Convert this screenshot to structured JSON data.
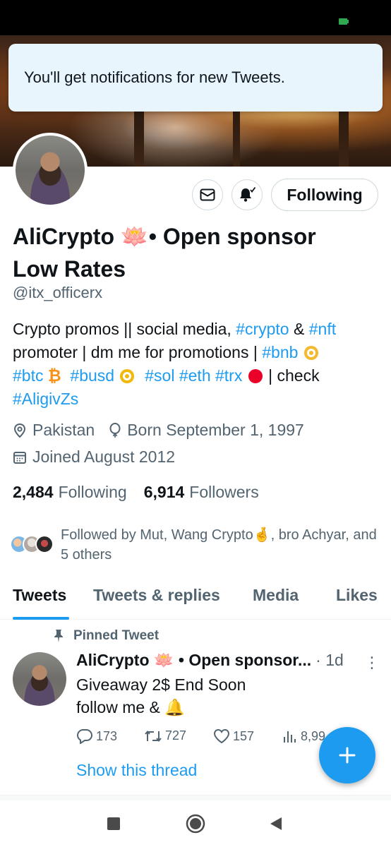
{
  "toast": {
    "message": "You'll get notifications for new Tweets."
  },
  "profile": {
    "display_name_part1": "AliCrypto ",
    "lotus_emoji": "🪷",
    "display_name_part2": "• Open sponsor",
    "display_name_line2": "Low Rates",
    "handle": "@itx_officerx",
    "follow_button": "Following",
    "bio": {
      "line1_text": "Crypto promos || social media, ",
      "tag_crypto": "#crypto",
      "amp": " & ",
      "tag_nft": "#nft",
      "line2_text": "promoter | dm me for promotions | ",
      "tag_bnb": "#bnb",
      "tag_btc": "#btc",
      "btc_symbol": "₿",
      "tag_busd": "#busd",
      "tag_sol": "#sol",
      "tag_eth": "#eth",
      "tag_trx": "#trx",
      "check_text": " | check",
      "tag_aligivzs": "#AligivZs"
    },
    "location": "Pakistan",
    "birthday": "Born September 1, 1997",
    "joined": "Joined August 2012",
    "following_count": "2,484",
    "following_label": "Following",
    "followers_count": "6,914",
    "followers_label": "Followers",
    "followed_by": "Followed by Mut, Wang Crypto🤞, bro Achyar, and 5 others"
  },
  "tabs": [
    {
      "label": "Tweets"
    },
    {
      "label": "Tweets & replies"
    },
    {
      "label": "Media"
    },
    {
      "label": "Likes"
    }
  ],
  "tweet": {
    "pinned_label": "Pinned Tweet",
    "name": "AliCrypto 🪷 • Open sponsor...",
    "time": "· 1d",
    "more": "⋮",
    "body_line1": "Giveaway 2$ End Soon",
    "body_line2": "follow me & 🔔",
    "replies": "173",
    "retweets": "727",
    "likes": "157",
    "views": "8,99",
    "show_thread": "Show this thread"
  },
  "colors": {
    "accent": "#1d9bf0",
    "text": "#0f1419",
    "secondary": "#536471",
    "toast_bg": "#e8f5fd"
  },
  "icons": [
    "envelope-icon",
    "bell-check-icon",
    "location-pin-icon",
    "balloon-icon",
    "calendar-icon",
    "pin-icon",
    "reply-icon",
    "retweet-icon",
    "like-icon",
    "views-icon",
    "compose-plus-icon",
    "nav-recents-icon",
    "nav-home-icon",
    "nav-back-icon"
  ]
}
